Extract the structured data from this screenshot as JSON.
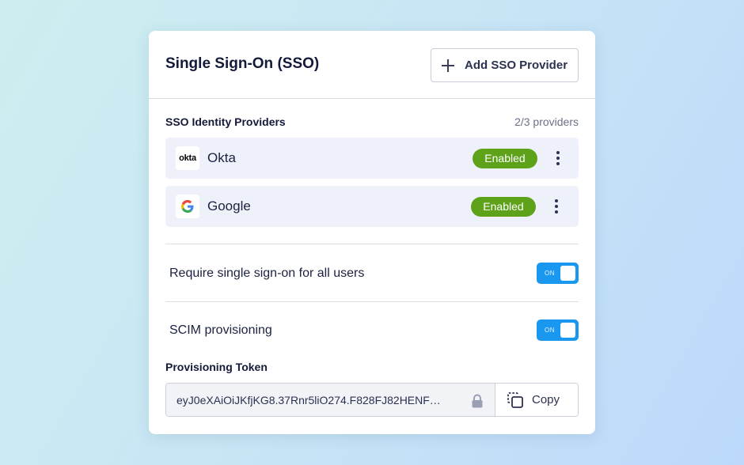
{
  "card": {
    "title": "Single Sign-On (SSO)",
    "add_button_label": "Add SSO Provider",
    "add_icon": "plus-icon"
  },
  "providers_section": {
    "title": "SSO Identity Providers",
    "count_text": "2/3 providers",
    "items": [
      {
        "name": "Okta",
        "logo_text": "okta",
        "status": "Enabled",
        "menu_icon": "kebab-menu-icon"
      },
      {
        "name": "Google",
        "logo": "google-g-icon",
        "status": "Enabled",
        "menu_icon": "kebab-menu-icon"
      }
    ]
  },
  "settings": {
    "require_sso": {
      "label": "Require single sign-on for all users",
      "toggle_text": "ON",
      "on": true
    },
    "scim": {
      "label": "SCIM provisioning",
      "toggle_text": "ON",
      "on": true
    }
  },
  "token": {
    "label": "Provisioning Token",
    "value": "eyJ0eXAiOiJKfjKG8.37Rnr5liO274.F828FJ82HENF…",
    "lock_icon": "lock-icon",
    "copy_label": "Copy",
    "copy_icon": "copy-icon"
  },
  "colors": {
    "badge_green": "#5ea21a",
    "toggle_blue": "#1a98f0",
    "row_bg": "#eff1fa",
    "text_dark": "#141a3a"
  }
}
